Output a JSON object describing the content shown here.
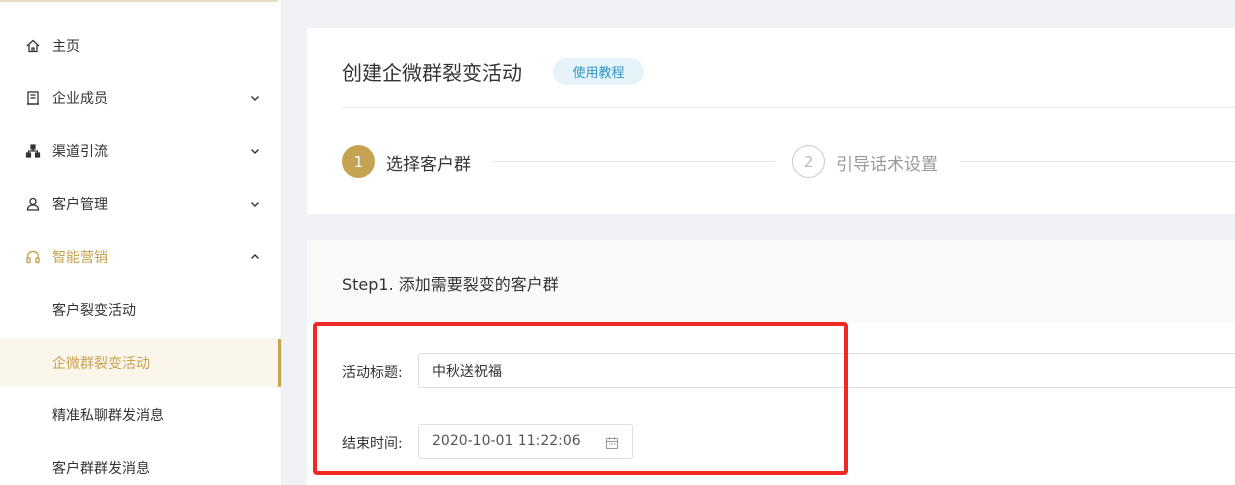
{
  "sidebar": {
    "items": [
      {
        "label": "主页",
        "icon": "home-icon"
      },
      {
        "label": "企业成员",
        "icon": "building-icon"
      },
      {
        "label": "渠道引流",
        "icon": "network-icon"
      },
      {
        "label": "客户管理",
        "icon": "user-icon"
      },
      {
        "label": "智能营销",
        "icon": "headset-icon"
      }
    ],
    "subitems": [
      {
        "label": "客户裂变活动"
      },
      {
        "label": "企微群裂变活动"
      },
      {
        "label": "精准私聊群发消息"
      },
      {
        "label": "客户群群发消息"
      }
    ]
  },
  "header": {
    "title": "创建企微群裂变活动",
    "tutorial_label": "使用教程"
  },
  "steps": [
    {
      "number": "1",
      "label": "选择客户群"
    },
    {
      "number": "2",
      "label": "引导话术设置"
    }
  ],
  "form": {
    "section_title": "Step1. 添加需要裂变的客户群",
    "title_label": "活动标题:",
    "title_value": "中秋送祝福",
    "end_time_label": "结束时间:",
    "end_time_value": "2020-10-01 11:22:06"
  },
  "colors": {
    "accent": "#c6a352",
    "highlight": "#ee2a22",
    "tag_text": "#2e96c6"
  }
}
